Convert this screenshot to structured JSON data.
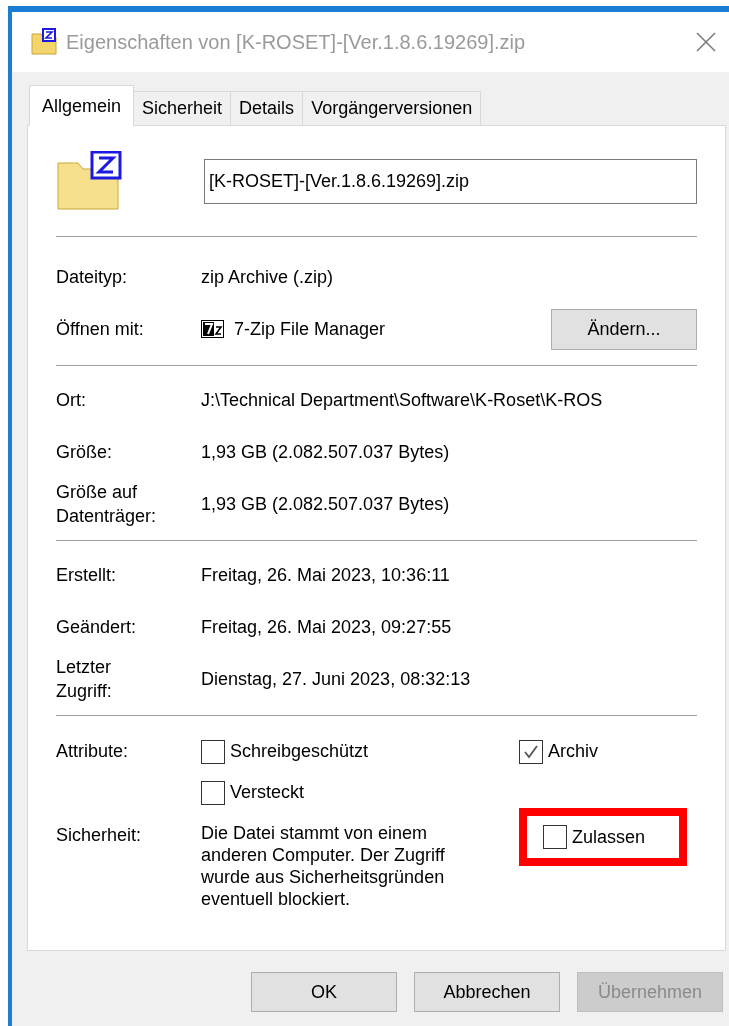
{
  "window": {
    "title": "Eigenschaften von [K-ROSET]-[Ver.1.8.6.19269].zip"
  },
  "tabs": [
    {
      "label": "Allgemein",
      "selected": true
    },
    {
      "label": "Sicherheit",
      "selected": false
    },
    {
      "label": "Details",
      "selected": false
    },
    {
      "label": "Vorgängerversionen",
      "selected": false
    }
  ],
  "file_name": "[K-ROSET]-[Ver.1.8.6.19269].zip",
  "sections": [
    [
      {
        "label": "Dateityp:",
        "value": "zip Archive (.zip)"
      },
      {
        "label": "Öffnen mit:",
        "value": "7-Zip File Manager",
        "kind": "app",
        "button": "Ändern..."
      }
    ],
    [
      {
        "label": "Ort:",
        "value": "J:\\Technical Department\\Software\\K-Roset\\K-ROS"
      },
      {
        "label": "Größe:",
        "value": "1,93 GB (2.082.507.037 Bytes)"
      },
      {
        "label": "Größe auf Datenträger:",
        "value": "1,93 GB (2.082.507.037 Bytes)"
      }
    ],
    [
      {
        "label": "Erstellt:",
        "value": "Freitag, 26. Mai 2023, 10:36:11"
      },
      {
        "label": "Geändert:",
        "value": "Freitag, 26. Mai 2023, 09:27:55"
      },
      {
        "label": "Letzter Zugriff:",
        "value": "Dienstag, 27. Juni 2023, 08:32:13"
      }
    ]
  ],
  "attributes": {
    "label": "Attribute:",
    "items": [
      {
        "label": "Schreibgeschützt",
        "checked": false
      },
      {
        "label": "Archiv",
        "checked": true
      },
      {
        "label": "Versteckt",
        "checked": false
      }
    ]
  },
  "security": {
    "label": "Sicherheit:",
    "text": "Die Datei stammt von einem anderen Computer. Der Zugriff wurde aus Sicherheitsgründen eventuell blockiert.",
    "checkbox": {
      "label": "Zulassen",
      "checked": false,
      "highlighted": true
    }
  },
  "buttons": [
    {
      "label": "OK",
      "disabled": false
    },
    {
      "label": "Abbrechen",
      "disabled": false
    },
    {
      "label": "Übernehmen",
      "disabled": true
    }
  ]
}
